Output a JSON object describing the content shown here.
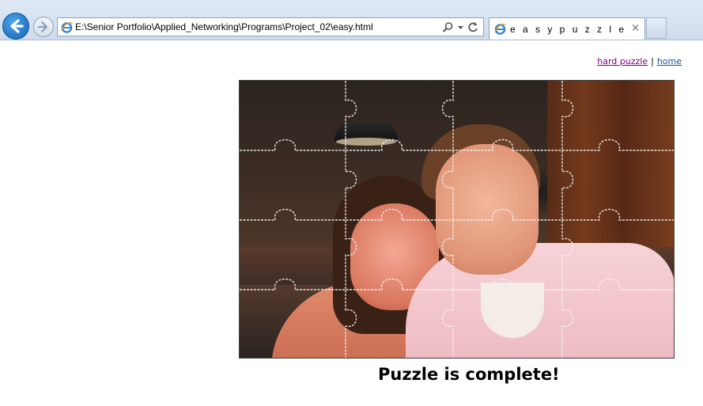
{
  "browser": {
    "address_url": "E:\\Senior Portfolio\\Applied_Networking\\Programs\\Project_02\\easy.html",
    "tab_title": "e a s y p u z z l e",
    "tab_close": "×"
  },
  "nav": {
    "hard_puzzle": "hard puzzle",
    "separator": "|",
    "home": "home"
  },
  "puzzle": {
    "status_message": "Puzzle is complete!",
    "grid_columns": 4,
    "grid_rows": 4
  },
  "icons": {
    "back": "back-arrow-icon",
    "forward": "forward-arrow-icon",
    "browser": "ie-logo-icon",
    "search": "search-icon",
    "dropdown": "chevron-down-icon",
    "refresh": "refresh-icon",
    "close": "close-icon"
  },
  "colors": {
    "link_visited": "#800080",
    "link_home": "#1a4f9c",
    "chrome_bg": "#dfe9f5"
  }
}
